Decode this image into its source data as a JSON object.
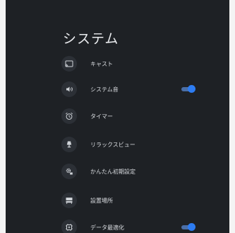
{
  "header": {
    "title": "システム"
  },
  "items": [
    {
      "label": "キャスト",
      "icon": "cast-icon"
    },
    {
      "label": "システム音",
      "icon": "volume-icon",
      "toggle": true
    },
    {
      "label": "タイマー",
      "icon": "alarm-icon"
    },
    {
      "label": "リラックスビュー",
      "icon": "lamp-icon"
    },
    {
      "label": "かんたん初期設定",
      "icon": "setup-icon"
    },
    {
      "label": "設置場所",
      "icon": "location-icon"
    },
    {
      "label": "データ最適化",
      "icon": "data-saver-icon",
      "toggle": true
    }
  ],
  "colors": {
    "panel": "#1e2125",
    "accent": "#2d7cf2"
  }
}
